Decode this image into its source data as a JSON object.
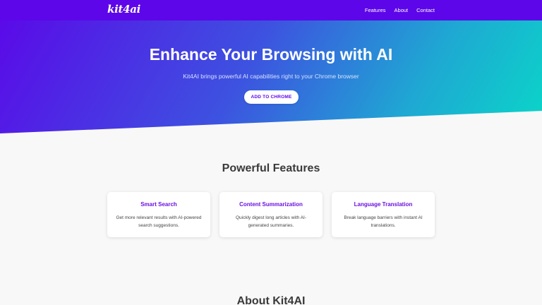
{
  "navbar": {
    "logo": "kit4ai",
    "links": [
      "Features",
      "About",
      "Contact"
    ]
  },
  "hero": {
    "title": "Enhance Your Browsing with AI",
    "subtitle": "Kit4AI brings powerful AI capabilities right to your Chrome browser",
    "cta_label": "ADD TO CHROME"
  },
  "features": {
    "title": "Powerful Features",
    "cards": [
      {
        "title": "Smart Search",
        "text": "Get more relevant results with AI-powered search suggestions."
      },
      {
        "title": "Content Summarization",
        "text": "Quickly digest long articles with AI-generated summaries."
      },
      {
        "title": "Language Translation",
        "text": "Break language barriers with instant AI translations."
      }
    ]
  },
  "about": {
    "title": "About Kit4AI"
  },
  "colors": {
    "brand": "#5d06e9",
    "gradient_end": "#0ad6c8",
    "card_title": "#6a0fe0"
  }
}
